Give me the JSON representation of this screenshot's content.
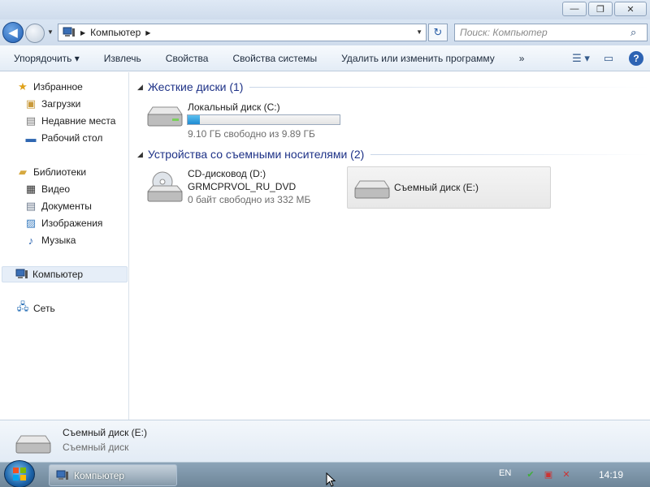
{
  "window": {
    "controls": {
      "minimize": "—",
      "maximize": "❐",
      "close": "✕"
    }
  },
  "address": {
    "path": "Компьютер",
    "search_placeholder": "Поиск: Компьютер"
  },
  "toolbar": {
    "items": [
      "Упорядочить ▾",
      "Извлечь",
      "Свойства",
      "Свойства системы",
      "Удалить или изменить программу",
      "»"
    ]
  },
  "nav": {
    "favorites": {
      "label": "Избранное",
      "items": [
        "Загрузки",
        "Недавние места",
        "Рабочий стол"
      ]
    },
    "libraries": {
      "label": "Библиотеки",
      "items": [
        "Видео",
        "Документы",
        "Изображения",
        "Музыка"
      ]
    },
    "computer": "Компьютер",
    "network": "Сеть"
  },
  "groups": {
    "hard_disks": {
      "title": "Жесткие диски (1)"
    },
    "removable": {
      "title": "Устройства со съемными носителями (2)"
    }
  },
  "drives": {
    "c": {
      "name": "Локальный диск (C:)",
      "free": "9.10 ГБ свободно из 9.89 ГБ",
      "used_fraction": 0.08
    },
    "d": {
      "name": "CD-дисковод (D:)",
      "label": "GRMCPRVOL_RU_DVD",
      "free": "0 байт свободно из 332 МБ"
    },
    "e": {
      "name": "Съемный диск (E:)"
    }
  },
  "details": {
    "name": "Съемный диск (E:)",
    "type": "Съемный диск"
  },
  "taskbar": {
    "window_label": "Компьютер",
    "language": "EN",
    "time": "14:19"
  },
  "colors": {
    "group_header": "#1e3287",
    "usage_fill": "#1f8bd2",
    "selection": "#e6eef8"
  }
}
